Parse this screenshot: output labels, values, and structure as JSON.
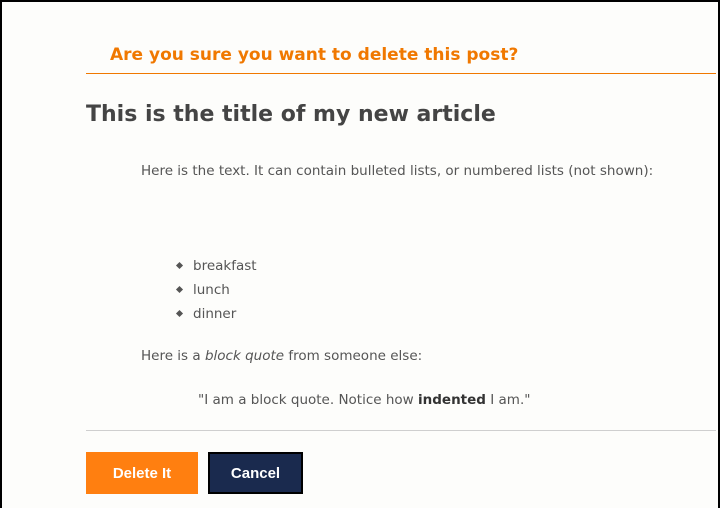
{
  "confirm": {
    "heading": "Are you sure you want to delete this post?"
  },
  "article": {
    "title": "This is the title of my new article",
    "intro": "Here is the text. It can contain bulleted lists, or numbered lists (not shown):",
    "list": [
      "breakfast",
      "lunch",
      "dinner"
    ],
    "quote_intro_before": "Here is a ",
    "quote_intro_em": "block quote",
    "quote_intro_after": " from someone else:",
    "quote_before": "\"I am a block quote. Notice how ",
    "quote_bold": "indented",
    "quote_after": " I am.\""
  },
  "actions": {
    "delete_label": "Delete It",
    "cancel_label": "Cancel"
  },
  "colors": {
    "accent": "#f07800",
    "delete_button": "#ff7f10",
    "cancel_button": "#1a2a4e"
  }
}
